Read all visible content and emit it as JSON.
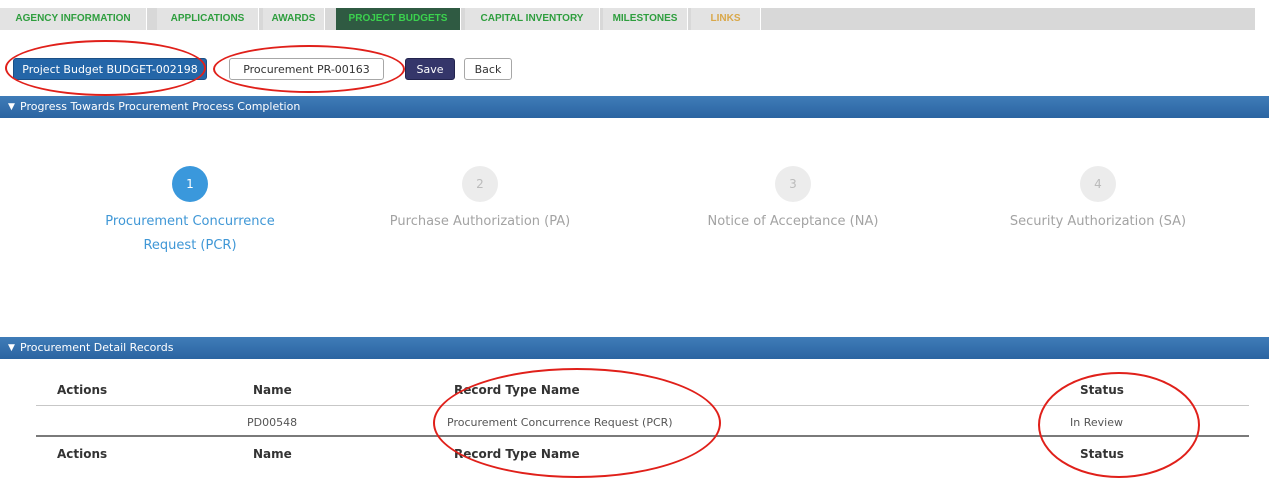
{
  "tabs": [
    {
      "label": "AGENCY INFORMATION",
      "state": "normal"
    },
    {
      "label": "APPLICATIONS",
      "state": "normal"
    },
    {
      "label": "AWARDS",
      "state": "normal"
    },
    {
      "label": "PROJECT BUDGETS",
      "state": "active"
    },
    {
      "label": "CAPITAL INVENTORY",
      "state": "normal"
    },
    {
      "label": "MILESTONES",
      "state": "normal"
    },
    {
      "label": "LINKS",
      "state": "plain"
    }
  ],
  "buttons": {
    "project_budget": "Project Budget BUDGET-002198",
    "procurement": "Procurement PR-00163",
    "save": "Save",
    "back": "Back"
  },
  "progress_section": {
    "title": "Progress Towards Procurement Process Completion",
    "steps": [
      {
        "number": "1",
        "label_line1": "Procurement Concurrence",
        "label_line2": "Request (PCR)",
        "state": "active"
      },
      {
        "number": "2",
        "label_line1": "Purchase Authorization (PA)",
        "label_line2": "",
        "state": "idle"
      },
      {
        "number": "3",
        "label_line1": "Notice of Acceptance (NA)",
        "label_line2": "",
        "state": "idle"
      },
      {
        "number": "4",
        "label_line1": "Security Authorization (SA)",
        "label_line2": "",
        "state": "idle"
      }
    ]
  },
  "records_section": {
    "title": "Procurement Detail Records",
    "columns": [
      "Actions",
      "Name",
      "Record Type Name",
      "Status"
    ],
    "rows": [
      {
        "actions": "",
        "name": "PD00548",
        "record_type": "Procurement Concurrence Request (PCR)",
        "status": "In Review"
      }
    ],
    "footer_columns": [
      "Actions",
      "Name",
      "Record Type Name",
      "Status"
    ]
  },
  "colors": {
    "accent_blue": "#2b64a1",
    "active_step": "#3a98dc",
    "annotation_red": "#e0201a",
    "tab_green": "#2e9e3e"
  }
}
